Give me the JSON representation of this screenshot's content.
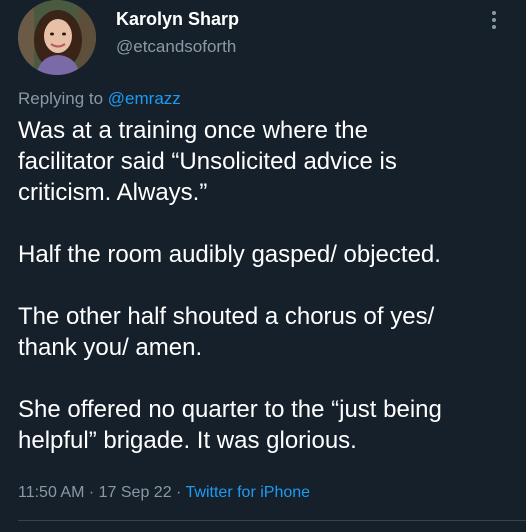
{
  "colors": {
    "background": "#15202b",
    "primary_text": "#ffffff",
    "secondary_text": "#8b98a5",
    "accent": "#1d9bf0",
    "divider": "#38444d"
  },
  "author": {
    "display_name": "Karolyn Sharp",
    "handle": "@etcandsoforth",
    "avatar_icon": "avatar-photo"
  },
  "more_icon": "vertical-ellipsis-icon",
  "reply": {
    "prefix": "Replying to ",
    "mention": "@emrazz"
  },
  "tweet": {
    "paragraphs": [
      "Was at a training once where the\nfacilitator said “Unsolicited advice is\ncriticism. Always.”",
      "Half the room audibly gasped/ objected.",
      "The other half shouted a chorus of yes/\nthank you/ amen.",
      "She offered no quarter to the “just being\nhelpful” brigade. It was glorious."
    ]
  },
  "meta": {
    "time": "11:50 AM",
    "separator1": " · ",
    "date": "17 Sep 22",
    "separator2": " · ",
    "source": "Twitter for iPhone"
  }
}
